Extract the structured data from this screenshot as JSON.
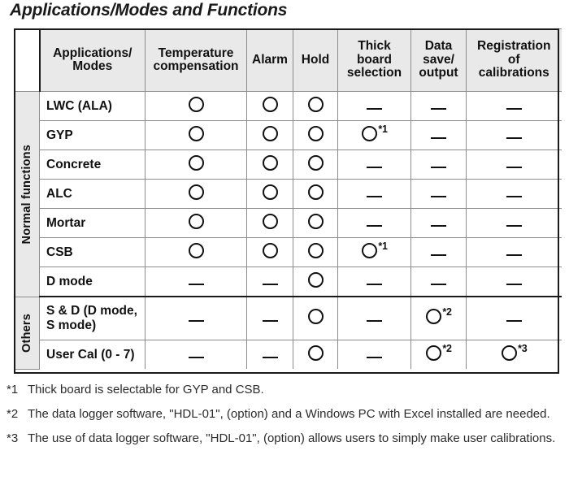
{
  "title": "Applications/Modes and Functions",
  "table": {
    "headers": {
      "group_blank": "",
      "modes": "Applications/\nModes",
      "columns": [
        "Temperature\ncompensation",
        "Alarm",
        "Hold",
        "Thick\nboard\nselection",
        "Data\nsave/\noutput",
        "Registration\nof\ncalibrations"
      ]
    },
    "groups": [
      {
        "label": "Normal functions",
        "rows": [
          {
            "mode": "LWC (ALA)",
            "cells": [
              {
                "symbol": "circle",
                "note": ""
              },
              {
                "symbol": "circle",
                "note": ""
              },
              {
                "symbol": "circle",
                "note": ""
              },
              {
                "symbol": "dash",
                "note": ""
              },
              {
                "symbol": "dash",
                "note": ""
              },
              {
                "symbol": "dash",
                "note": ""
              }
            ]
          },
          {
            "mode": "GYP",
            "cells": [
              {
                "symbol": "circle",
                "note": ""
              },
              {
                "symbol": "circle",
                "note": ""
              },
              {
                "symbol": "circle",
                "note": ""
              },
              {
                "symbol": "circle",
                "note": "*1"
              },
              {
                "symbol": "dash",
                "note": ""
              },
              {
                "symbol": "dash",
                "note": ""
              }
            ]
          },
          {
            "mode": "Concrete",
            "cells": [
              {
                "symbol": "circle",
                "note": ""
              },
              {
                "symbol": "circle",
                "note": ""
              },
              {
                "symbol": "circle",
                "note": ""
              },
              {
                "symbol": "dash",
                "note": ""
              },
              {
                "symbol": "dash",
                "note": ""
              },
              {
                "symbol": "dash",
                "note": ""
              }
            ]
          },
          {
            "mode": "ALC",
            "cells": [
              {
                "symbol": "circle",
                "note": ""
              },
              {
                "symbol": "circle",
                "note": ""
              },
              {
                "symbol": "circle",
                "note": ""
              },
              {
                "symbol": "dash",
                "note": ""
              },
              {
                "symbol": "dash",
                "note": ""
              },
              {
                "symbol": "dash",
                "note": ""
              }
            ]
          },
          {
            "mode": "Mortar",
            "cells": [
              {
                "symbol": "circle",
                "note": ""
              },
              {
                "symbol": "circle",
                "note": ""
              },
              {
                "symbol": "circle",
                "note": ""
              },
              {
                "symbol": "dash",
                "note": ""
              },
              {
                "symbol": "dash",
                "note": ""
              },
              {
                "symbol": "dash",
                "note": ""
              }
            ]
          },
          {
            "mode": "CSB",
            "cells": [
              {
                "symbol": "circle",
                "note": ""
              },
              {
                "symbol": "circle",
                "note": ""
              },
              {
                "symbol": "circle",
                "note": ""
              },
              {
                "symbol": "circle",
                "note": "*1"
              },
              {
                "symbol": "dash",
                "note": ""
              },
              {
                "symbol": "dash",
                "note": ""
              }
            ]
          },
          {
            "mode": "D mode",
            "cells": [
              {
                "symbol": "dash",
                "note": ""
              },
              {
                "symbol": "dash",
                "note": ""
              },
              {
                "symbol": "circle",
                "note": ""
              },
              {
                "symbol": "dash",
                "note": ""
              },
              {
                "symbol": "dash",
                "note": ""
              },
              {
                "symbol": "dash",
                "note": ""
              }
            ]
          }
        ]
      },
      {
        "label": "Others",
        "rows": [
          {
            "mode": "S & D (D mode,\nS mode)",
            "cells": [
              {
                "symbol": "dash",
                "note": ""
              },
              {
                "symbol": "dash",
                "note": ""
              },
              {
                "symbol": "circle",
                "note": ""
              },
              {
                "symbol": "dash",
                "note": ""
              },
              {
                "symbol": "circle",
                "note": "*2"
              },
              {
                "symbol": "dash",
                "note": ""
              }
            ]
          },
          {
            "mode": "User Cal (0 - 7)",
            "cells": [
              {
                "symbol": "dash",
                "note": ""
              },
              {
                "symbol": "dash",
                "note": ""
              },
              {
                "symbol": "circle",
                "note": ""
              },
              {
                "symbol": "dash",
                "note": ""
              },
              {
                "symbol": "circle",
                "note": "*2"
              },
              {
                "symbol": "circle",
                "note": "*3"
              }
            ]
          }
        ]
      }
    ]
  },
  "footnotes": [
    {
      "mark": "*1",
      "text": "Thick board is selectable for GYP and CSB."
    },
    {
      "mark": "*2",
      "text": "The data logger software, \"HDL-01\", (option) and a Windows PC with Excel installed are needed."
    },
    {
      "mark": "*3",
      "text": "The use of data logger software, \"HDL-01\", (option) allows users to simply make user calibrations."
    }
  ],
  "colors": {
    "header_background": "#e9e9ea",
    "border": "#1a1a1a",
    "grid": "#8c8c8c",
    "text": "#111111"
  }
}
